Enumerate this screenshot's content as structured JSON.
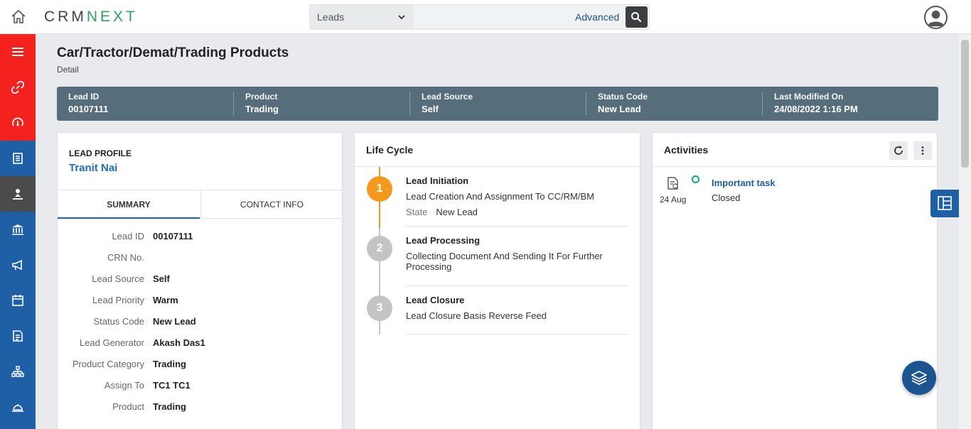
{
  "app": {
    "logo_main": "CRM",
    "logo_accent": "NEXT"
  },
  "search": {
    "module": "Leads",
    "placeholder": "",
    "advanced_label": "Advanced"
  },
  "sidebar": {
    "items": [
      {
        "icon": "hamburger-menu-icon"
      },
      {
        "icon": "link-icon"
      },
      {
        "icon": "dashboard-gauge-icon"
      },
      {
        "icon": "document-list-icon"
      },
      {
        "icon": "user-lead-icon"
      },
      {
        "icon": "bank-icon"
      },
      {
        "icon": "megaphone-icon"
      },
      {
        "icon": "calendar-icon"
      },
      {
        "icon": "report-icon"
      },
      {
        "icon": "hierarchy-icon"
      },
      {
        "icon": "service-bell-icon"
      }
    ]
  },
  "page": {
    "title": "Car/Tractor/Demat/Trading Products",
    "subtitle": "Detail"
  },
  "info_strip": [
    {
      "label": "Lead ID",
      "value": "00107111"
    },
    {
      "label": "Product",
      "value": "Trading"
    },
    {
      "label": "Lead Source",
      "value": "Self"
    },
    {
      "label": "Status Code",
      "value": "New Lead"
    },
    {
      "label": "Last Modified On",
      "value": "24/08/2022 1:16 PM"
    }
  ],
  "profile": {
    "label": "LEAD PROFILE",
    "name": "Tranit Nai",
    "tabs": [
      "SUMMARY",
      "CONTACT INFO"
    ],
    "fields": [
      {
        "label": "Lead ID",
        "value": "00107111"
      },
      {
        "label": "CRN No.",
        "value": ""
      },
      {
        "label": "Lead Source",
        "value": "Self"
      },
      {
        "label": "Lead Priority",
        "value": "Warm"
      },
      {
        "label": "Status Code",
        "value": "New Lead"
      },
      {
        "label": "Lead Generator",
        "value": "Akash Das1"
      },
      {
        "label": "Product Category",
        "value": "Trading"
      },
      {
        "label": "Assign To",
        "value": "TC1 TC1"
      },
      {
        "label": "Product",
        "value": "Trading"
      }
    ]
  },
  "lifecycle": {
    "title": "Life Cycle",
    "steps": [
      {
        "number": "1",
        "title": "Lead Initiation",
        "desc": "Lead Creation And Assignment To CC/RM/BM",
        "state_label": "State",
        "state_value": "New Lead"
      },
      {
        "number": "2",
        "title": "Lead Processing",
        "desc": "Collecting Document And Sending It For Further Processing"
      },
      {
        "number": "3",
        "title": "Lead Closure",
        "desc": "Lead Closure Basis Reverse Feed"
      }
    ],
    "active_color": "#f39a1e",
    "inactive_color": "#c4c4c4"
  },
  "activities": {
    "title": "Activities",
    "items": [
      {
        "date": "24 Aug",
        "title": "Important task",
        "status": "Closed"
      }
    ]
  },
  "colors": {
    "sidebar": "#1e5fa5",
    "sidebar_red": "#f3221f",
    "strip": "#566d7b"
  }
}
